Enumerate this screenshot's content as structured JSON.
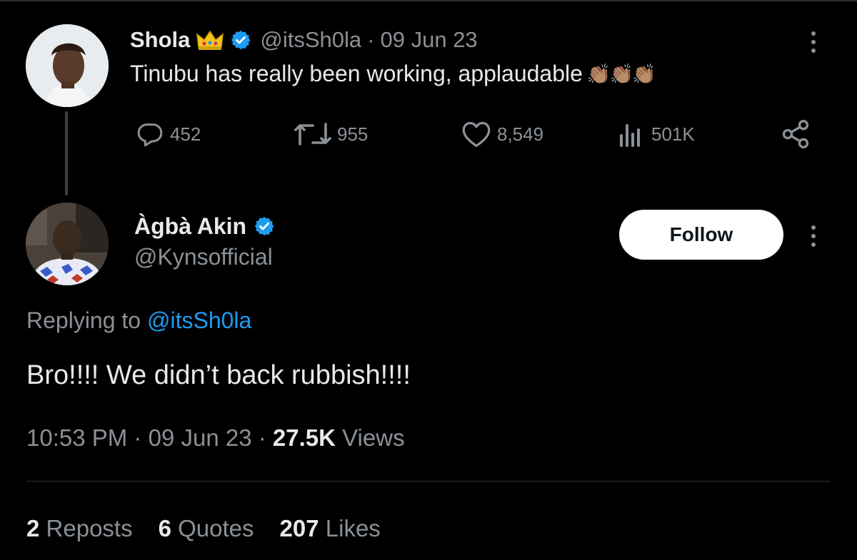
{
  "parent_tweet": {
    "name": "Shola",
    "handle": "@itsSh0la",
    "separator": "·",
    "date": "09 Jun 23",
    "text": "Tinubu has really been working, applaudable",
    "emoji": "👏🏽👏🏽👏🏽",
    "replies": "452",
    "reposts": "955",
    "likes": "8,549",
    "views": "501K"
  },
  "focus_tweet": {
    "name": "Àgbà Akin",
    "handle": "@Kynsofficial",
    "follow_label": "Follow",
    "replying_prefix": "Replying to",
    "replying_handle": "@itsSh0la",
    "text": "Bro!!!! We didn’t back rubbish!!!!",
    "time": "10:53 PM",
    "date": "09 Jun 23",
    "separator": "·",
    "views_count": "27.5K",
    "views_label": "Views",
    "reposts_count": "2",
    "reposts_label": "Reposts",
    "quotes_count": "6",
    "quotes_label": "Quotes",
    "likes_count": "207",
    "likes_label": "Likes"
  },
  "colors": {
    "background": "#000000",
    "text": "#e7e9ea",
    "secondary": "#8b9196",
    "verified": "#1d9bf0",
    "link": "#1d9bf0"
  },
  "icons": [
    "crown-icon",
    "verified-badge-icon",
    "more-options-icon",
    "reply-icon",
    "retweet-icon",
    "heart-icon",
    "views-icon",
    "share-icon"
  ]
}
